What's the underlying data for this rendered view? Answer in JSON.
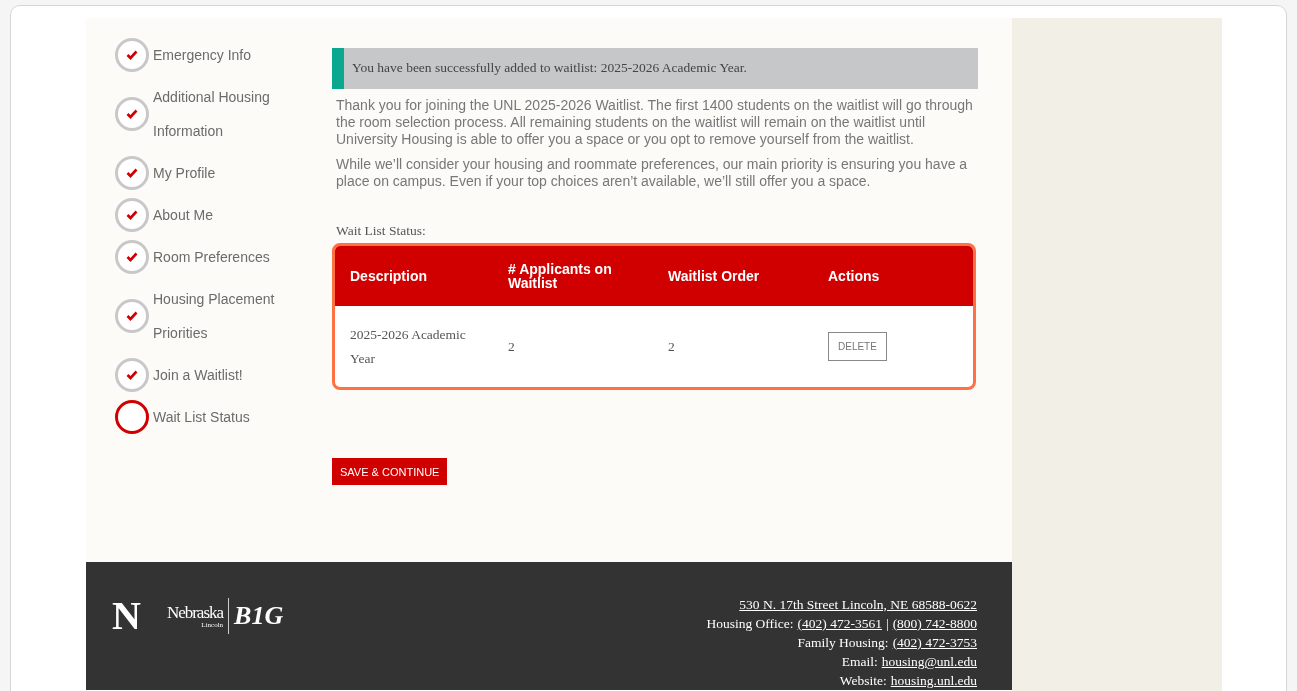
{
  "sidebar": {
    "items": [
      {
        "label": "Emergency Info",
        "completed": true
      },
      {
        "label": "Additional Housing Information",
        "completed": true
      },
      {
        "label": "My Profile",
        "completed": true
      },
      {
        "label": "About Me",
        "completed": true
      },
      {
        "label": "Room Preferences",
        "completed": true
      },
      {
        "label": "Housing Placement Priorities",
        "completed": true
      },
      {
        "label": "Join a Waitlist!",
        "completed": true
      },
      {
        "label": "Wait List Status",
        "completed": false
      }
    ]
  },
  "alert": {
    "message": "You have been successfully added to waitlist: 2025-2026 Academic Year."
  },
  "paragraphs": [
    "Thank you for joining the UNL 2025-2026 Waitlist. The first 1400 students on the waitlist will go through the room selection process. All remaining students on the waitlist will remain on the waitlist until University Housing is able to offer you a space or you opt to remove yourself from the waitlist.",
    "While we’ll consider your housing and roommate preferences, our main priority is ensuring you have a place on campus. Even if your top choices aren’t available, we’ll still offer you a space."
  ],
  "table": {
    "label": "Wait List Status:",
    "columns": [
      "Description",
      "# Applicants on Waitlist",
      "Waitlist Order",
      "Actions"
    ],
    "rows": [
      {
        "description": "2025-2026 Academic Year",
        "applicants": "2",
        "order": "2",
        "action": "DELETE"
      }
    ]
  },
  "save_button": "SAVE & CONTINUE",
  "footer": {
    "logo": {
      "mark": "N",
      "name": "Nebraska",
      "city": "Lincoln",
      "conference": "B1G"
    },
    "lines": [
      [
        {
          "kind": "link",
          "text": "530 N. 17th Street Lincoln, NE 68588-0622"
        }
      ],
      [
        {
          "kind": "text",
          "text": "Housing Office:"
        },
        {
          "kind": "link",
          "text": "(402) 472-3561"
        },
        {
          "kind": "text",
          "text": "|"
        },
        {
          "kind": "link",
          "text": "(800) 742-8800"
        }
      ],
      [
        {
          "kind": "text",
          "text": "Family Housing:"
        },
        {
          "kind": "link",
          "text": "(402) 472-3753"
        }
      ],
      [
        {
          "kind": "text",
          "text": "Email:"
        },
        {
          "kind": "link",
          "text": "housing@unl.edu"
        }
      ],
      [
        {
          "kind": "text",
          "text": "Website:"
        },
        {
          "kind": "link",
          "text": "housing.unl.edu"
        }
      ]
    ]
  }
}
